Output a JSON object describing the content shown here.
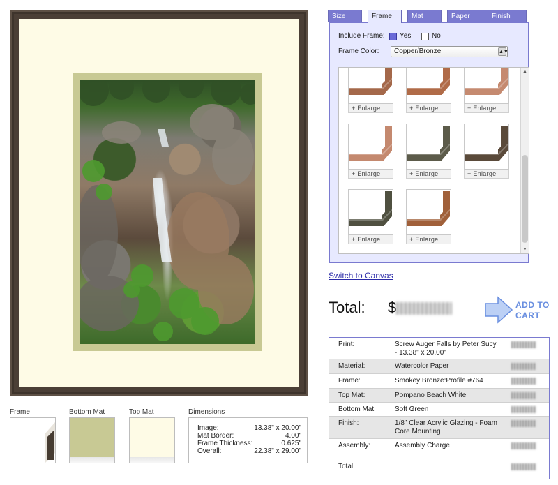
{
  "preview": {
    "frame_color": "#4b3f36",
    "top_mat_color": "#fefbe6",
    "bottom_mat_color": "#c8c994"
  },
  "swatches": {
    "frame_label": "Frame",
    "bottom_mat_label": "Bottom Mat",
    "top_mat_label": "Top Mat",
    "dimensions_label": "Dimensions"
  },
  "dimensions": [
    {
      "key": "Image:",
      "value": "13.38\" x 20.00\""
    },
    {
      "key": "Mat Border:",
      "value": "4.00\""
    },
    {
      "key": "Frame Thickness:",
      "value": "0.625\""
    },
    {
      "key": "Overall:",
      "value": "22.38\" x 29.00\""
    }
  ],
  "tabs": [
    {
      "label": "Size",
      "active": false
    },
    {
      "label": "Frame",
      "active": true
    },
    {
      "label": "Mat",
      "active": false
    },
    {
      "label": "Paper",
      "active": false
    },
    {
      "label": "Finish",
      "active": false
    }
  ],
  "frame_panel": {
    "include_label": "Include Frame:",
    "yes_label": "Yes",
    "no_label": "No",
    "yes_checked": true,
    "color_label": "Frame Color:",
    "color_value": "Copper/Bronze",
    "enlarge_label": "+ Enlarge",
    "frames": [
      {
        "color": "#a4684a"
      },
      {
        "color": "#b06b48"
      },
      {
        "color": "#c58a70"
      },
      {
        "color": "#c4896f"
      },
      {
        "color": "#5c5b4a"
      },
      {
        "color": "#5a4a3a"
      },
      {
        "color": "#4f5040"
      },
      {
        "color": "#a0603a"
      }
    ]
  },
  "switch_link": "Switch to Canvas",
  "total": {
    "label": "Total:",
    "currency": "$"
  },
  "cart": {
    "line1": "ADD TO",
    "line2": "CART"
  },
  "summary": [
    {
      "key": "Print:",
      "value": "Screw Auger Falls by Peter Sucy - 13.38\" x 20.00\""
    },
    {
      "key": "Material:",
      "value": "Watercolor Paper"
    },
    {
      "key": "Frame:",
      "value": "Smokey Bronze:Profile #764"
    },
    {
      "key": "Top Mat:",
      "value": "Pompano Beach White"
    },
    {
      "key": "Bottom Mat:",
      "value": "Soft Green"
    },
    {
      "key": "Finish:",
      "value": "1/8\" Clear Acrylic Glazing - Foam Core Mounting"
    },
    {
      "key": "Assembly:",
      "value": "Assembly Charge"
    },
    {
      "key": "Total:",
      "value": ""
    }
  ]
}
